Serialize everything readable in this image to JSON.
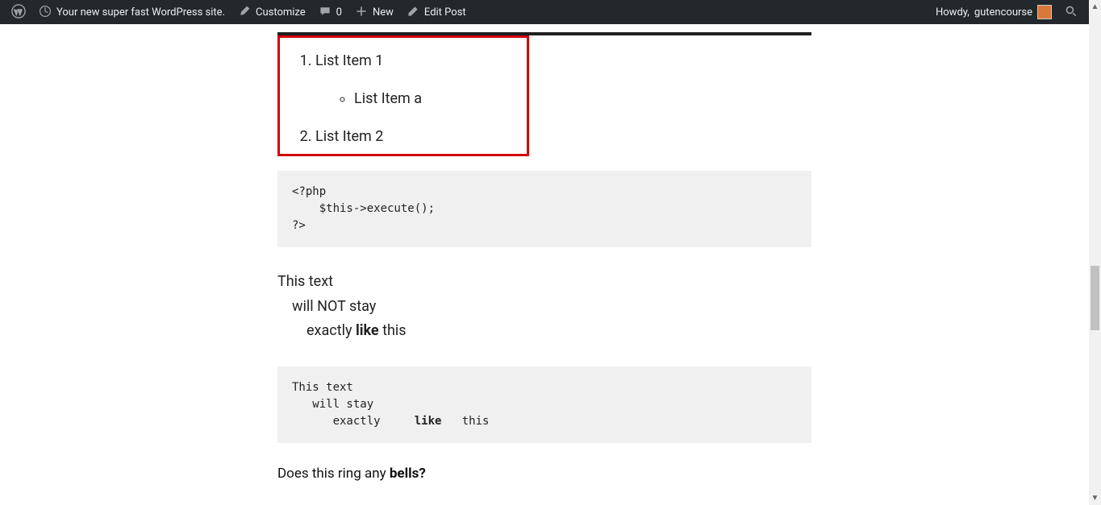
{
  "adminbar": {
    "site_name": "Your new super fast WordPress site.",
    "customize": "Customize",
    "comments_count": "0",
    "new": "New",
    "edit_post": "Edit Post",
    "howdy_prefix": "Howdy, ",
    "username": "gutencourse"
  },
  "list": {
    "item1": "List Item 1",
    "sub_a": "List Item a",
    "item2": "List Item 2"
  },
  "code_php": "<?php\n    $this->execute();\n?>",
  "varied": {
    "line1": "This text",
    "line2": "will NOT stay",
    "line3_pre": "exactly    ",
    "line3_bold": "like",
    "line3_post": " this"
  },
  "preformat": "This text\n   will stay\n      exactly     like   this",
  "preformat_parts": {
    "before": "This text\n   will stay\n      exactly     ",
    "bold": "like",
    "after": "   this"
  },
  "bells": {
    "pre": "Does this ring any ",
    "bold": "bells?"
  }
}
